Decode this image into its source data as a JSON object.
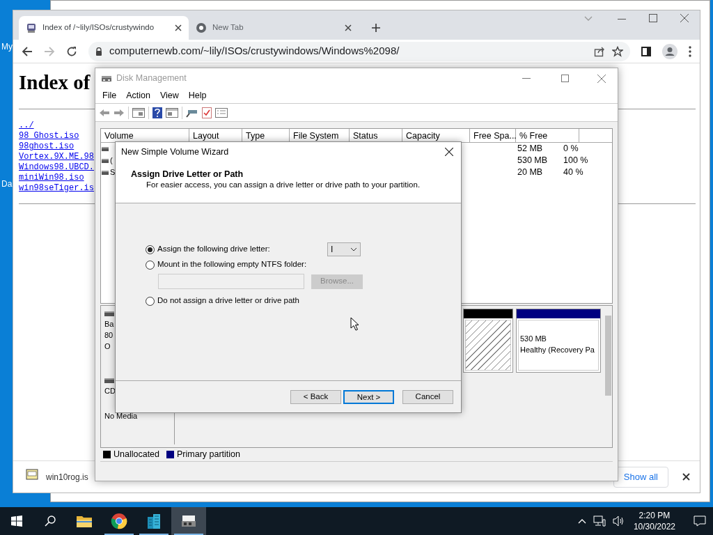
{
  "desktop_icons": [
    {
      "label": "My"
    },
    {
      "label": "Da"
    }
  ],
  "browser": {
    "tabs": [
      {
        "title": "Index of /~lily/ISOs/crustywindo",
        "selected": true
      },
      {
        "title": "New Tab",
        "selected": false
      }
    ],
    "url": "computernewb.com/~lily/ISOs/crustywindows/Windows%2098/",
    "page": {
      "heading": "Index of",
      "links": [
        "../",
        "98_Ghost.iso",
        "98ghost.iso",
        "Vortex.9X.ME.98",
        "Windows98.UBCD.",
        "miniWin98.iso",
        "win98seTiger.is"
      ]
    },
    "downloads": {
      "file": "win10rog.is",
      "show_all": "Show all"
    }
  },
  "disk_management": {
    "title": "Disk Management",
    "menu": [
      "File",
      "Action",
      "View",
      "Help"
    ],
    "columns": [
      "Volume",
      "Layout",
      "Type",
      "File System",
      "Status",
      "Capacity",
      "Free Spa...",
      "% Free"
    ],
    "rows": [
      {
        "free_space": "52 MB",
        "percent_free": "0 %"
      },
      {
        "volume": "(",
        "free_space": "530 MB",
        "percent_free": "100 %"
      },
      {
        "volume": "S",
        "free_space": "20 MB",
        "percent_free": "40 %"
      }
    ],
    "disks": [
      {
        "kind": "disk",
        "label_lines": [
          "Ba",
          "80",
          "O"
        ],
        "partitions": [
          {
            "kind": "unallocated"
          },
          {
            "kind": "primary",
            "size": "530 MB",
            "status": "Healthy (Recovery Pa"
          }
        ]
      },
      {
        "kind": "cdrom",
        "label_lines": [
          "CD"
        ],
        "status": "No Media"
      }
    ],
    "legend": [
      {
        "label": "Unallocated",
        "color": "#000000"
      },
      {
        "label": "Primary partition",
        "color": "#000080"
      }
    ]
  },
  "wizard": {
    "title": "New Simple Volume Wizard",
    "heading": "Assign Drive Letter or Path",
    "subheading": "For easier access, you can assign a drive letter or drive path to your partition.",
    "options": [
      {
        "kind": "letter",
        "label": "Assign the following drive letter:",
        "selected": true,
        "value": "I"
      },
      {
        "kind": "folder",
        "label": "Mount in the following empty NTFS folder:",
        "selected": false,
        "browse": {
          "label": "Browse...",
          "disabled": true
        }
      },
      {
        "kind": "none",
        "label": "Do not assign a drive letter or drive path",
        "selected": false
      }
    ],
    "buttons": [
      {
        "label": "< Back",
        "default": false
      },
      {
        "label": "Next >",
        "default": true
      },
      {
        "label": "Cancel",
        "default": false
      }
    ]
  },
  "taskbar": {
    "apps": [
      {
        "kind": "folder",
        "running": false,
        "selected": false
      },
      {
        "kind": "chrome",
        "running": true,
        "selected": false
      },
      {
        "kind": "buildings",
        "running": true,
        "selected": false
      },
      {
        "kind": "disk",
        "running": true,
        "selected": true
      }
    ],
    "time": "2:20 PM",
    "date": "10/30/2022"
  }
}
